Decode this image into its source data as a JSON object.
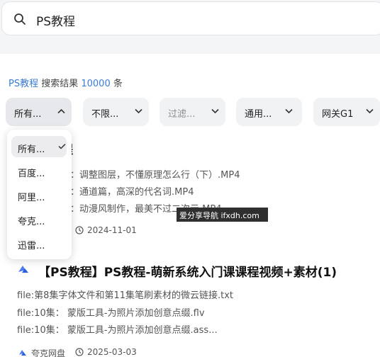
{
  "search": {
    "query": "PS教程"
  },
  "results": {
    "query": "PS教程",
    "label": " 搜索结果 ",
    "count": "10000",
    "unit": " 条"
  },
  "filters": [
    {
      "label": "所有...",
      "active": true
    },
    {
      "label": "不限..."
    },
    {
      "label": "过滤..."
    },
    {
      "label": "通用..."
    },
    {
      "label": "网关G1"
    }
  ],
  "dropdown": {
    "items": [
      {
        "label": "所有...",
        "selected": true
      },
      {
        "label": "百度..."
      },
      {
        "label": "阿里..."
      },
      {
        "label": "夸克..."
      },
      {
        "label": "迅雷..."
      }
    ]
  },
  "result1": {
    "title_tail": "程",
    "files": [
      "集：调整图层，不懂原理怎么行（下）.MP4",
      "集：通道篇，高深的代名词.MP4",
      "集：动漫风制作，最美不过二次元.MP4..."
    ],
    "date": "2024-11-01"
  },
  "result2": {
    "title": "【PS教程】PS教程-萌新系统入门课课程视频+素材(1)",
    "files": [
      "file:第8集字体文件和第11集笔刷素材的微云链接.txt",
      "file:10集：  蒙版工具-为照片添加创意点缀.flv",
      "file:10集：  蒙版工具-为照片添加创意点缀.ass..."
    ],
    "source": "夸克网盘",
    "date": "2025-03-03"
  },
  "watermark": "爱分享导航 ifxdh.com",
  "colors": {
    "accent": "#3a7bd5",
    "filter_bg": "#f1f2f4",
    "band_bg": "#f4f5f7"
  }
}
